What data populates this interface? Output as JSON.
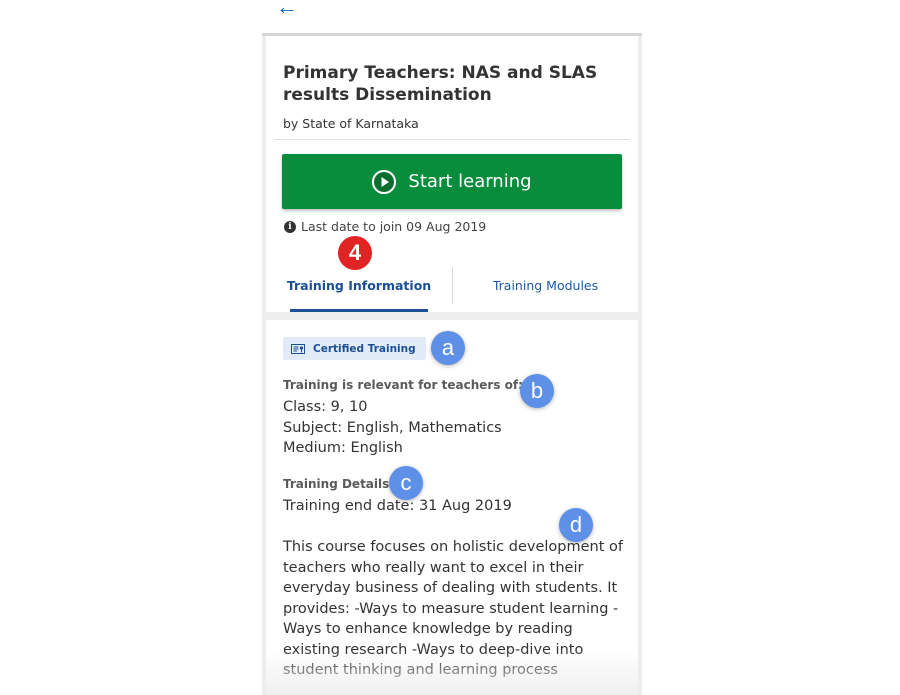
{
  "nav": {
    "back_icon": "arrow-left-icon",
    "back_glyph": "←"
  },
  "course": {
    "title": "Primary Teachers: NAS and SLAS results Dissemination",
    "organization": "by State of Karnataka"
  },
  "actions": {
    "start_label": "Start learning",
    "start_icon": "play-icon",
    "start_color": "#078d3b"
  },
  "enrollment": {
    "info_icon": "info-icon",
    "info_glyph": "i",
    "last_date_text": "Last date to join 09 Aug 2019"
  },
  "tabs": [
    {
      "label": "Training Information",
      "active": true
    },
    {
      "label": "Training Modules",
      "active": false
    }
  ],
  "details": {
    "badge_label": "Certified Training",
    "relevance_heading": "Training is relevant for teachers of:",
    "class_line": "Class: 9, 10",
    "subject_line": "Subject: English, Mathematics",
    "medium_line": "Medium: English",
    "details_heading": "Training Details",
    "end_date_line": "Training end date: 31 Aug 2019",
    "description": "This course focuses on holistic development of teachers who really want to excel in their everyday business of dealing with students. It provides: -Ways to measure student learning -Ways to enhance knowledge by reading existing research -Ways to deep-dive into student thinking and learning process"
  },
  "annotations": {
    "step": "4",
    "a": "a",
    "b": "b",
    "c": "c",
    "d": "d"
  },
  "colors": {
    "accent": "#1a4f95",
    "cta": "#078d3b",
    "step_marker": "#e02424",
    "callout": "#5d90e6"
  }
}
